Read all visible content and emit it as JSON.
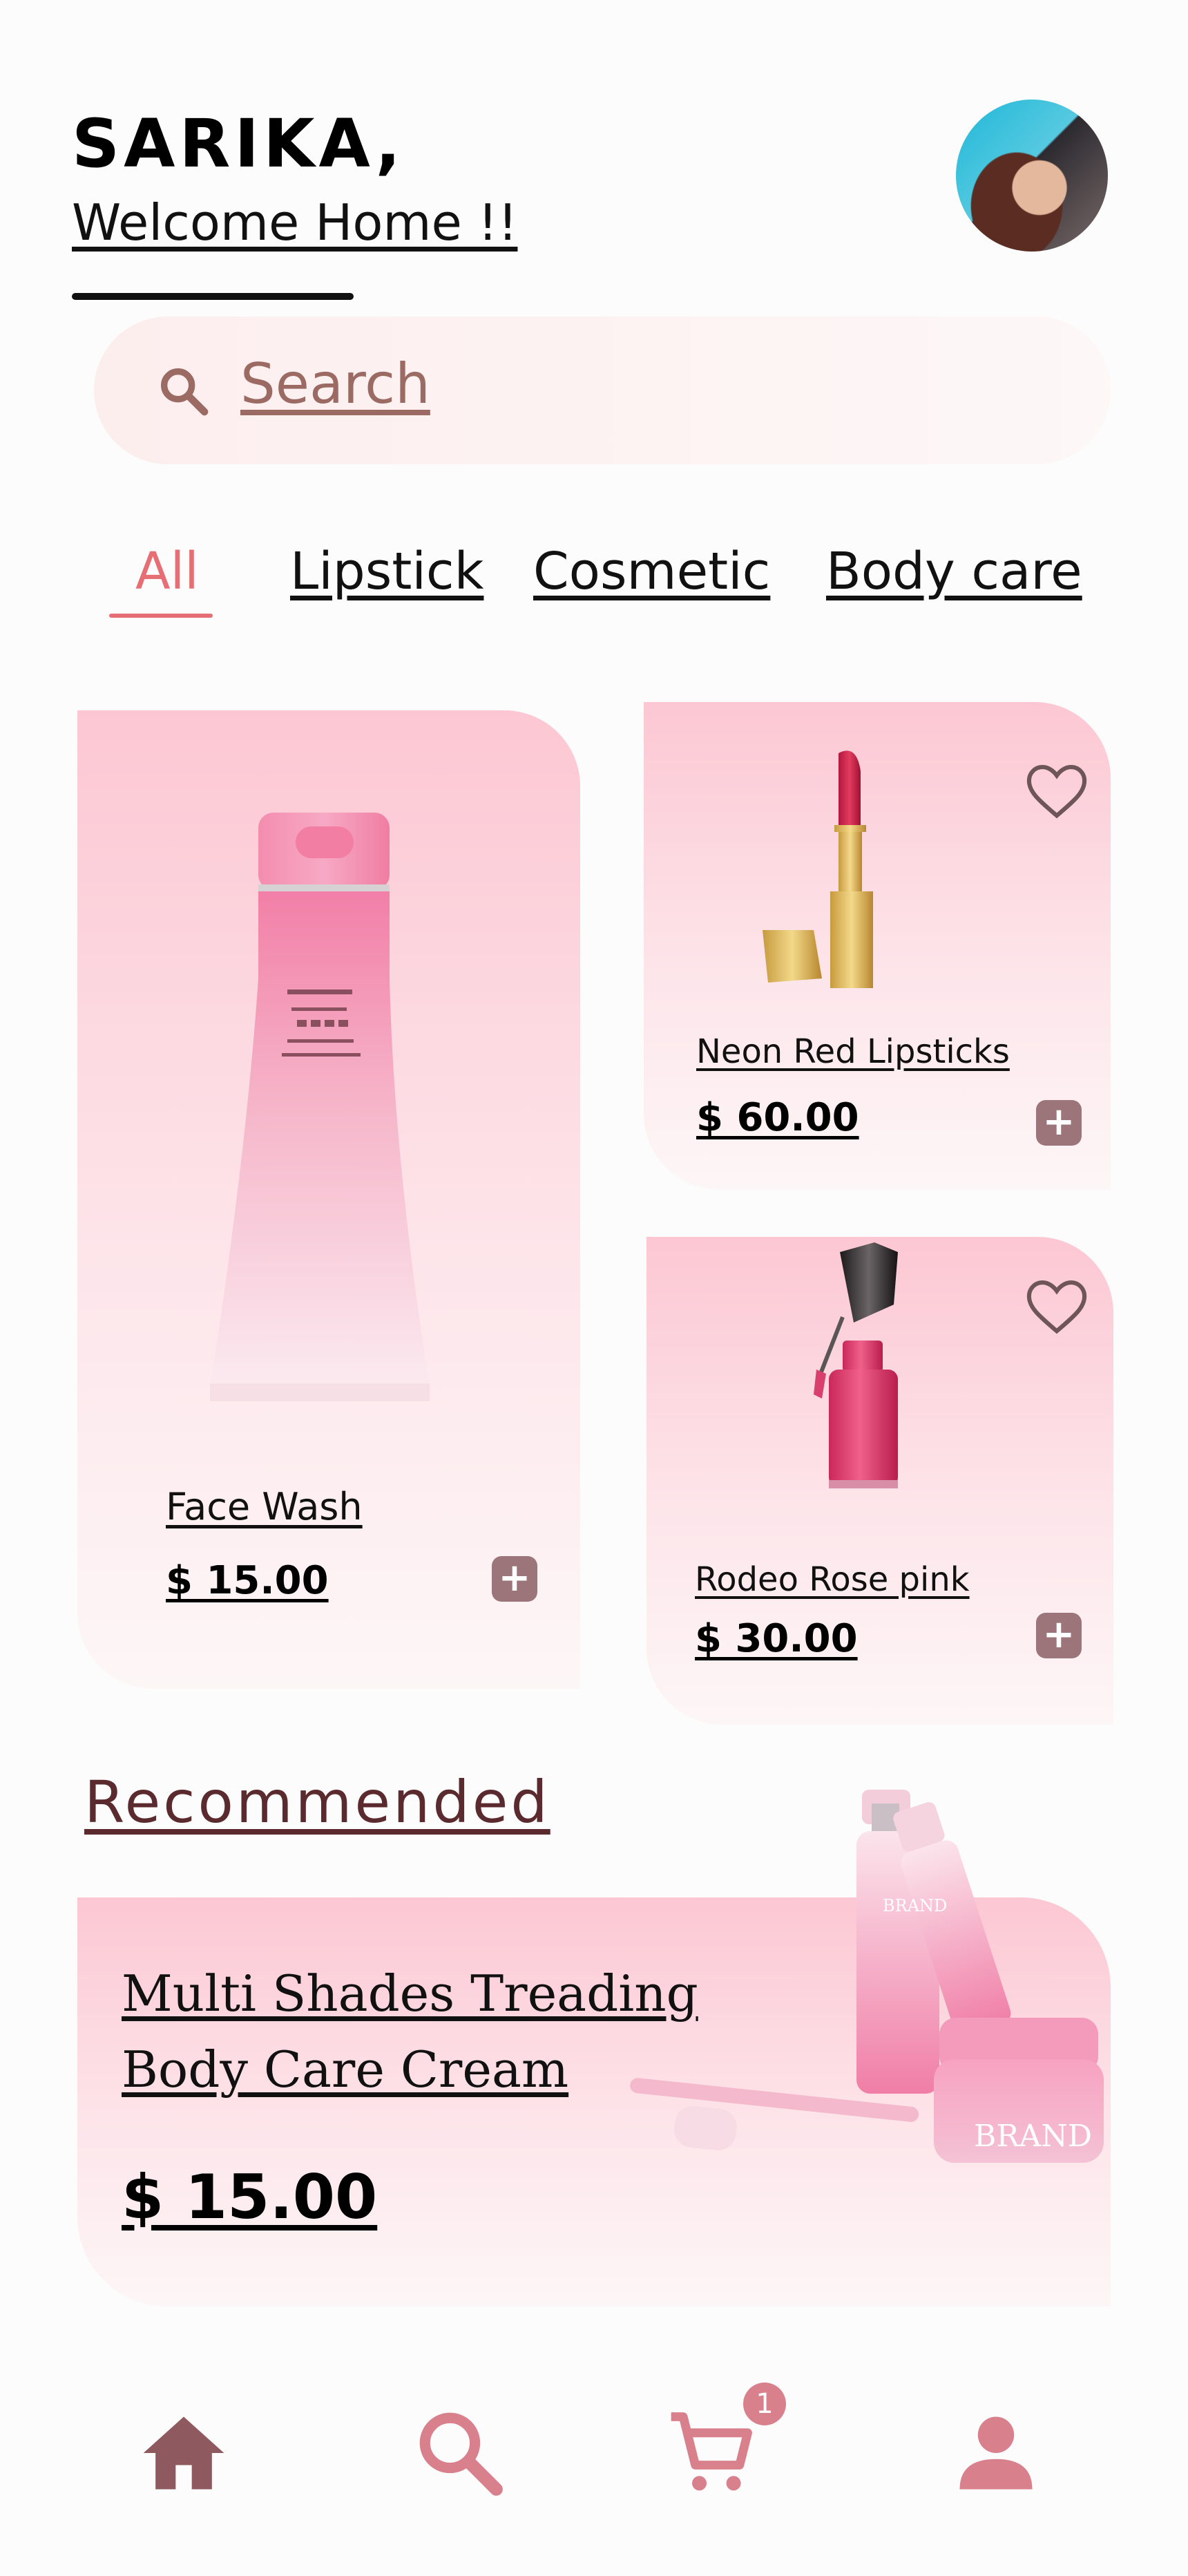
{
  "header": {
    "name": "SARIKA,",
    "welcome": "Welcome Home !!"
  },
  "search": {
    "placeholder": "Search",
    "icon": "search-icon"
  },
  "tabs": [
    {
      "label": "All",
      "active": true
    },
    {
      "label": "Lipstick",
      "active": false
    },
    {
      "label": "Cosmetic",
      "active": false
    },
    {
      "label": "Body care",
      "active": false
    }
  ],
  "products": [
    {
      "name": "Face Wash",
      "price": "$ 15.00",
      "image": "face-wash-tube"
    },
    {
      "name": "Neon Red Lipsticks",
      "price": "$ 60.00",
      "image": "red-lipstick",
      "favorite_icon": "heart-icon"
    },
    {
      "name": "Rodeo Rose pink",
      "price": "$ 30.00",
      "image": "pink-nail-polish",
      "favorite_icon": "heart-icon"
    }
  ],
  "recommended": {
    "title": "Recommended",
    "item_name": "Multi Shades Treading Body Care Cream",
    "price": "$ 15.00",
    "brand_label": "BRAND"
  },
  "nav": {
    "items": [
      "home-icon",
      "search-icon",
      "cart-icon",
      "profile-icon"
    ],
    "cart_count": "1"
  },
  "colors": {
    "accent": "#e56f74",
    "card_top": "#fcc7d3",
    "nav_active": "#8e5a60",
    "nav_inactive": "#d9808d",
    "plus_button": "#9b7579"
  }
}
